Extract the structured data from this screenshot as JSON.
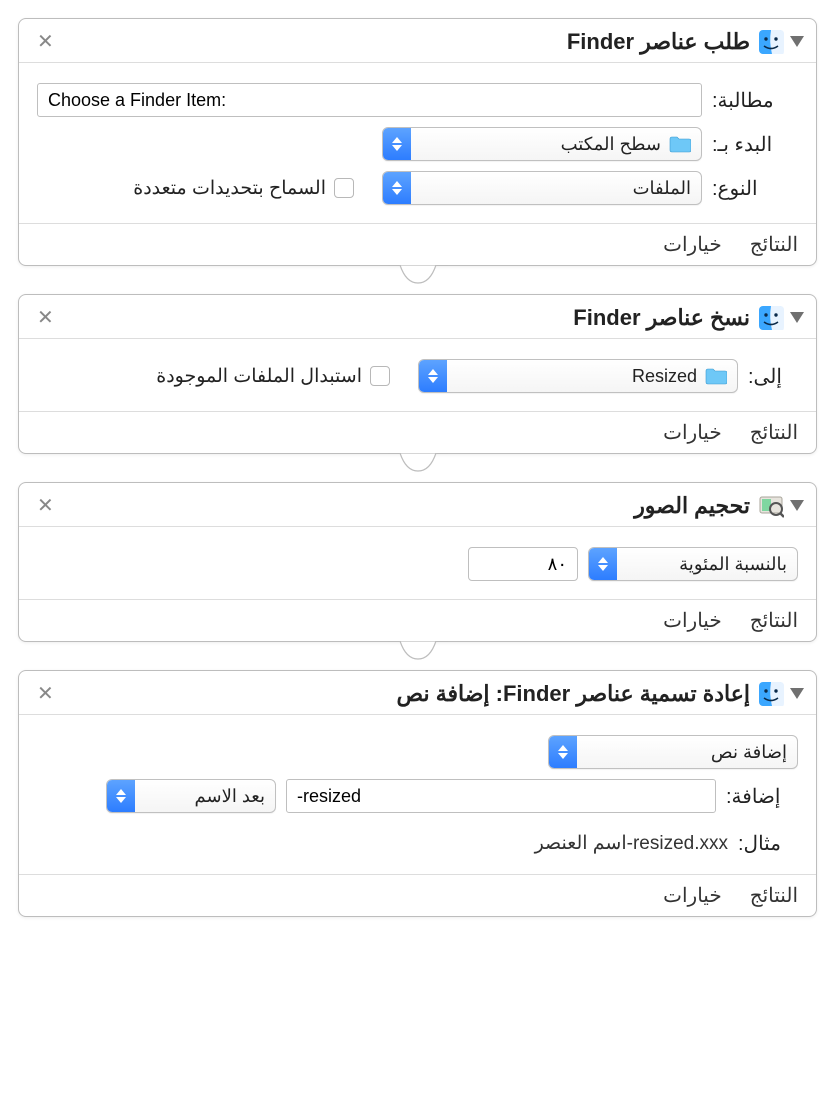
{
  "common": {
    "results": "النتائج",
    "options": "خيارات"
  },
  "action1": {
    "title": "طلب عناصر Finder",
    "prompt_label": "مطالبة:",
    "prompt_value": "Choose a Finder Item:",
    "start_label": "البدء بـ:",
    "start_value": "سطح المكتب",
    "type_label": "النوع:",
    "type_value": "الملفات",
    "multi_label": "السماح بتحديدات متعددة"
  },
  "action2": {
    "title": "نسخ عناصر Finder",
    "to_label": "إلى:",
    "to_value": "Resized",
    "replace_label": "استبدال الملفات الموجودة"
  },
  "action3": {
    "title": "تحجيم الصور",
    "mode_value": "بالنسبة المئوية",
    "percent_value": "٨٠"
  },
  "action4": {
    "title": "إعادة تسمية عناصر Finder: إضافة نص",
    "mode_value": "إضافة نص",
    "add_label": "إضافة:",
    "add_value": "-resized",
    "position_value": "بعد الاسم",
    "example_label": "مثال:",
    "example_value": "اسم العنصر-resized.xxx"
  }
}
